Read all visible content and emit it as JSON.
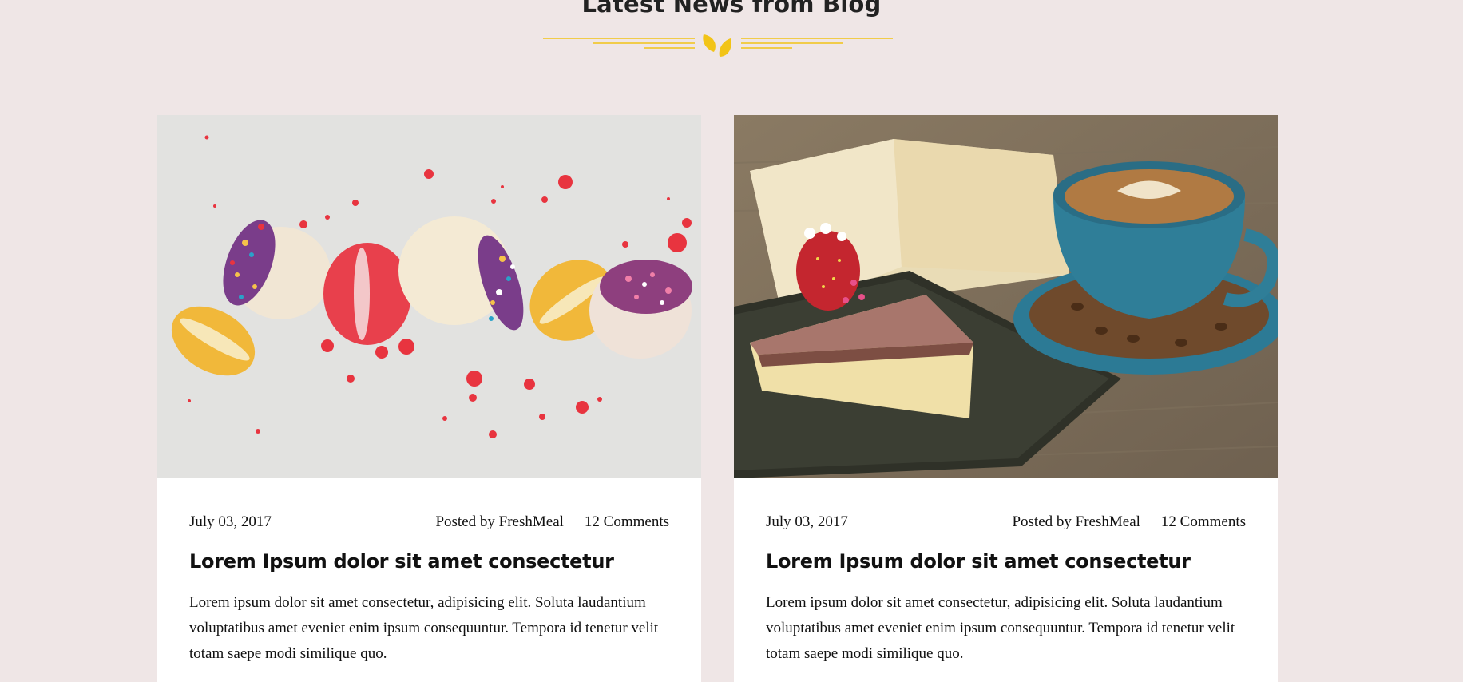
{
  "section": {
    "title": "Latest News from Blog",
    "accent_color": "#f2c417",
    "divider_icon": "leaves-icon"
  },
  "posts": [
    {
      "image": "macarons-photo",
      "date": "July 03, 2017",
      "author": "Posted by FreshMeal",
      "comments": "12 Comments",
      "title": "Lorem Ipsum dolor sit amet consectetur",
      "excerpt": "Lorem ipsum dolor sit amet consectetur, adipisicing elit. Soluta laudantium voluptatibus amet eveniet enim ipsum consequuntur. Tempora id tenetur velit totam saepe modi similique quo."
    },
    {
      "image": "cake-coffee-photo",
      "date": "July 03, 2017",
      "author": "Posted by FreshMeal",
      "comments": "12 Comments",
      "title": "Lorem Ipsum dolor sit amet consectetur",
      "excerpt": "Lorem ipsum dolor sit amet consectetur, adipisicing elit. Soluta laudantium voluptatibus amet eveniet enim ipsum consequuntur. Tempora id tenetur velit totam saepe modi similique quo."
    }
  ]
}
